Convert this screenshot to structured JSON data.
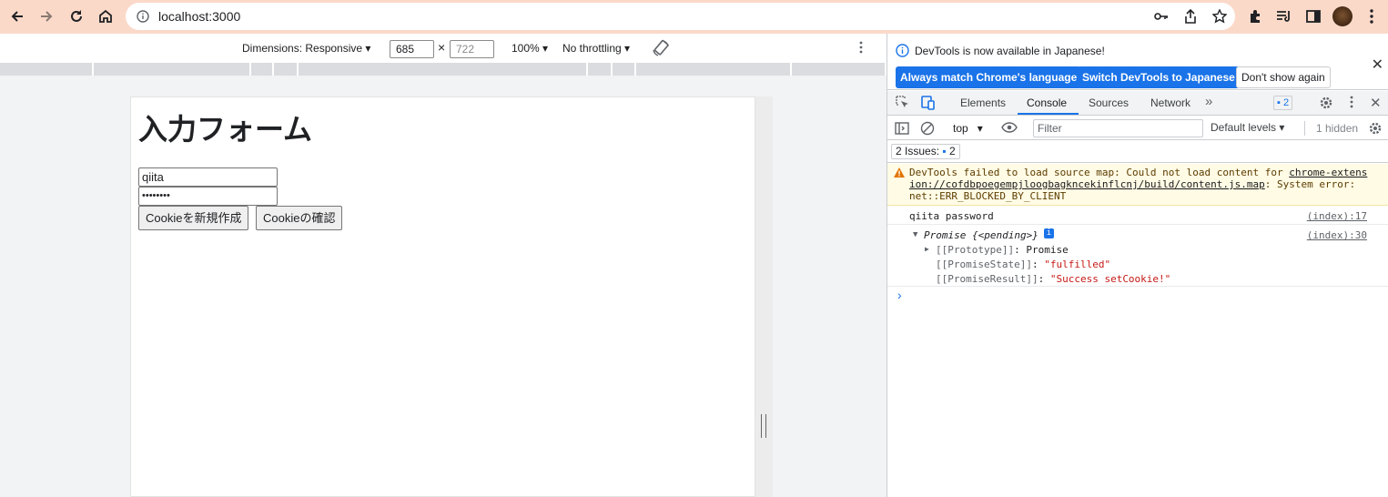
{
  "browser": {
    "url": "localhost:3000"
  },
  "device_toolbar": {
    "dimensions_label": "Dimensions: Responsive",
    "width": "685",
    "height": "722",
    "times": "×",
    "zoom": "100%",
    "throttling": "No throttling"
  },
  "page": {
    "title": "入力フォーム",
    "username_value": "qiita",
    "password_value": "••••••••",
    "create_cookie_button": "Cookieを新規作成",
    "check_cookie_button": "Cookieの確認"
  },
  "devtools": {
    "infobar": {
      "message": "DevTools is now available in Japanese!",
      "match_button": "Always match Chrome's language",
      "switch_button": "Switch DevTools to Japanese",
      "dismiss_button": "Don't show again"
    },
    "tabs": {
      "elements": "Elements",
      "console": "Console",
      "sources": "Sources",
      "network": "Network"
    },
    "issues_badge_count": "2",
    "console_toolbar": {
      "context": "top",
      "filter_placeholder": "Filter",
      "levels": "Default levels",
      "hidden_count": "1 hidden"
    },
    "issues_bar": {
      "label": "2 Issues:",
      "count": "2"
    },
    "messages": {
      "warning_prefix": "DevTools failed to load source map: Could not load content for ",
      "warning_link_1": "chrome-extens",
      "warning_link_2": "ion://cofdbpoegempjloogbagkncekinflcnj/build/content.js.map",
      "warning_suffix": ": System error:",
      "warning_line_3": "net::ERR_BLOCKED_BY_CLIENT",
      "log1_text": "qiita password",
      "log1_source": "(index):17",
      "log2_head": "Promise {<pending>}",
      "log2_source": "(index):30",
      "prototype_key": "[[Prototype]]",
      "prototype_val": "Promise",
      "state_key": "[[PromiseState]]",
      "state_val": "\"fulfilled\"",
      "result_key": "[[PromiseResult]]",
      "result_val": "\"Success setCookie!\""
    }
  }
}
